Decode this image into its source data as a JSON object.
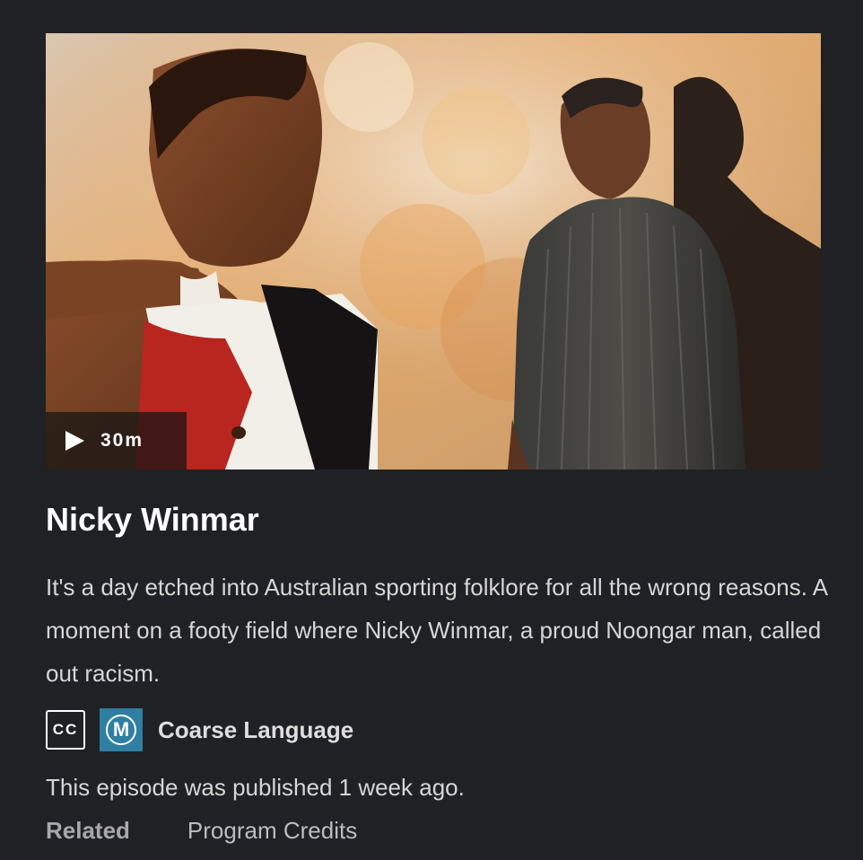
{
  "episode": {
    "duration": "30m",
    "title": "Nicky Winmar",
    "description": "It's a day etched into Australian sporting folklore for all the wrong reasons. A moment on a footy field where Nicky Winmar, a proud Noongar man, called out racism.",
    "published": "This episode was published 1 week ago."
  },
  "ratings": {
    "cc_label": "CC",
    "classification": "M",
    "advice": "Coarse Language"
  },
  "tabs": {
    "related": "Related",
    "credits": "Program Credits"
  },
  "icons": {
    "play": "play-icon",
    "cc": "closed-captions-icon",
    "rating": "m-rating-icon"
  },
  "colors": {
    "background": "#202124",
    "rating_badge": "#2f7fa3"
  }
}
